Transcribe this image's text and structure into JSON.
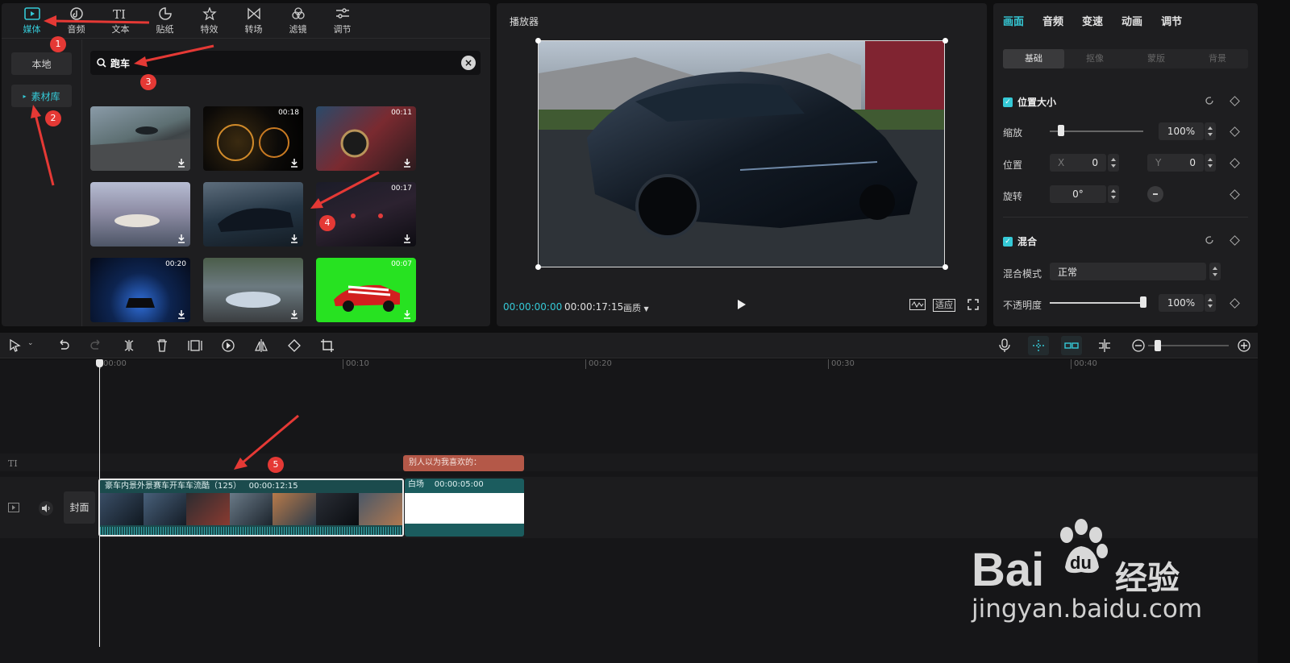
{
  "media_tabs": [
    {
      "label": "媒体",
      "icon": "media-icon",
      "active": true
    },
    {
      "label": "音频",
      "icon": "audio-icon"
    },
    {
      "label": "文本",
      "icon": "text-icon"
    },
    {
      "label": "贴纸",
      "icon": "sticker-icon"
    },
    {
      "label": "特效",
      "icon": "effect-icon"
    },
    {
      "label": "转场",
      "icon": "transition-icon"
    },
    {
      "label": "滤镜",
      "icon": "filter-icon"
    },
    {
      "label": "调节",
      "icon": "adjust-icon"
    }
  ],
  "side": {
    "local": "本地",
    "library": "素材库"
  },
  "search": {
    "query": "跑车"
  },
  "thumbs": [
    {
      "duration": ""
    },
    {
      "duration": "00:18"
    },
    {
      "duration": "00:11"
    },
    {
      "duration": ""
    },
    {
      "duration": ""
    },
    {
      "duration": "00:17"
    },
    {
      "duration": "00:20"
    },
    {
      "duration": ""
    },
    {
      "duration": "00:07"
    }
  ],
  "player": {
    "title": "播放器",
    "current_time": "00:00:00:00",
    "total_time": "00:00:17:15",
    "quality": "画质",
    "fit": "适应"
  },
  "props": {
    "tabs": [
      "画面",
      "音频",
      "变速",
      "动画",
      "调节"
    ],
    "subtabs": [
      "基础",
      "抠像",
      "蒙版",
      "背景"
    ],
    "section_position": "位置大小",
    "scale_label": "缩放",
    "scale_value": "100%",
    "scale_level": 0.12,
    "position_label": "位置",
    "x_label": "X",
    "x_value": "0",
    "y_label": "Y",
    "y_value": "0",
    "rotate_label": "旋转",
    "rotate_value": "0°",
    "section_blend": "混合",
    "blend_mode_label": "混合模式",
    "blend_mode_value": "正常",
    "opacity_label": "不透明度",
    "opacity_value": "100%",
    "opacity_level": 1.0
  },
  "ruler": [
    "00:00",
    "00:10",
    "00:20",
    "00:30",
    "00:40"
  ],
  "timeline": {
    "text_clip": "别人以为我喜欢的：",
    "main_clip_title": "豪车内景外景赛车开车车流酷（125）",
    "main_clip_duration": "00:00:12:15",
    "white_clip_title": "白场",
    "white_clip_duration": "00:00:05:00",
    "cover": "封面"
  },
  "annotations": [
    "1",
    "2",
    "3",
    "4",
    "5"
  ],
  "watermark": {
    "brand": "Bai",
    "brand_suffix": "du",
    "cn": "经验",
    "url": "jingyan.baidu.com"
  },
  "colors": {
    "accent": "#35c9d6",
    "annotation": "#e53935",
    "text_clip": "#b45848",
    "video_clip": "#1b4b4d"
  }
}
